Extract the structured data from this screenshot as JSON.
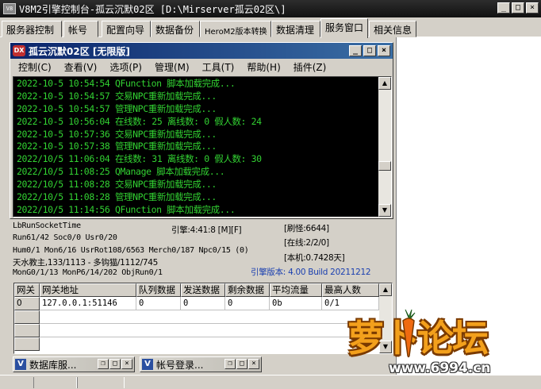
{
  "window": {
    "title": "V8M2引擎控制台-孤云沉默02区 [D:\\Mirserver孤云02区\\]",
    "icon": "app-icon",
    "buttons": [
      "_",
      "□",
      "×"
    ]
  },
  "tabs": [
    {
      "label": "服务器控制",
      "active": false
    },
    {
      "label": "帐号",
      "active": false
    },
    {
      "label": "配置向导",
      "active": false
    },
    {
      "label": "数据备份",
      "active": false
    },
    {
      "label": "HeroM2版本转换",
      "active": false
    },
    {
      "label": "数据清理",
      "active": false
    },
    {
      "label": "服务窗口",
      "active": true
    },
    {
      "label": "相关信息",
      "active": false
    }
  ],
  "engine": {
    "title": "孤云沉默02区 [无限版]",
    "icon_text": "DX",
    "buttons": [
      "_",
      "□",
      "×"
    ],
    "menu": [
      "控制(C)",
      "查看(V)",
      "选项(P)",
      "管理(M)",
      "工具(T)",
      "帮助(H)",
      "插件(Z)"
    ],
    "log": [
      "2022-10-5 10:54:54 QFunction 脚本加载完成...",
      "2022-10-5 10:54:57 交易NPC重新加载完成...",
      "2022-10-5 10:54:57 管理NPC重新加载完成...",
      "2022-10-5 10:56:04 在线数: 25 离线数: 0 假人数: 24",
      "2022-10-5 10:57:36 交易NPC重新加载完成...",
      "2022-10-5 10:57:38 管理NPC重新加载完成...",
      "2022/10/5 11:06:04 在线数: 31 离线数: 0 假人数: 30",
      "2022/10/5 11:08:25 QManage 脚本加载完成...",
      "2022/10/5 11:08:28 交易NPC重新加载完成...",
      "2022/10/5 11:08:28 管理NPC重新加载完成...",
      "2022/10/5 11:14:56 QFunction 脚本加载完成..."
    ]
  },
  "status": {
    "socket_time": "LbRunSocketTime",
    "run": "Run61/42 Soc0/0 Usr0/20",
    "engine_time": "引擎:4:41:8 [M][F]",
    "refresh": "[刷怪:6644]",
    "online": "[在线:2/2/0]",
    "machine": "[本机:0.7428天]",
    "hum": "Hum0/1 Mon6/16 UsrRot108/6563 Merch0/187 Npc0/15 (0)",
    "map": "天水教主,133/1113 - 多钩猫/1112/745",
    "mon": "MonG0/1/13 MonP6/14/202 ObjRun0/1",
    "version": "引擎版本: 4.00 Build 20211212"
  },
  "gateway": {
    "columns": [
      "网关",
      "网关地址",
      "队列数据",
      "发送数据",
      "剩余数据",
      "平均流量",
      "最高人数"
    ],
    "rows": [
      [
        "0",
        "127.0.0.1:51146",
        "0",
        "0",
        "0",
        "0b",
        "0/1"
      ]
    ]
  },
  "minimized": [
    {
      "label": "数据库服...",
      "icon": "V"
    },
    {
      "label": "帐号登录...",
      "icon": "V"
    }
  ],
  "watermark": {
    "title": "萝卜论坛",
    "url": "www.6994.cn"
  },
  "colors": {
    "log_text": "#32d232",
    "log_bg": "#000000",
    "title_active": "#0a246a",
    "version_text": "#1a3fb0"
  }
}
